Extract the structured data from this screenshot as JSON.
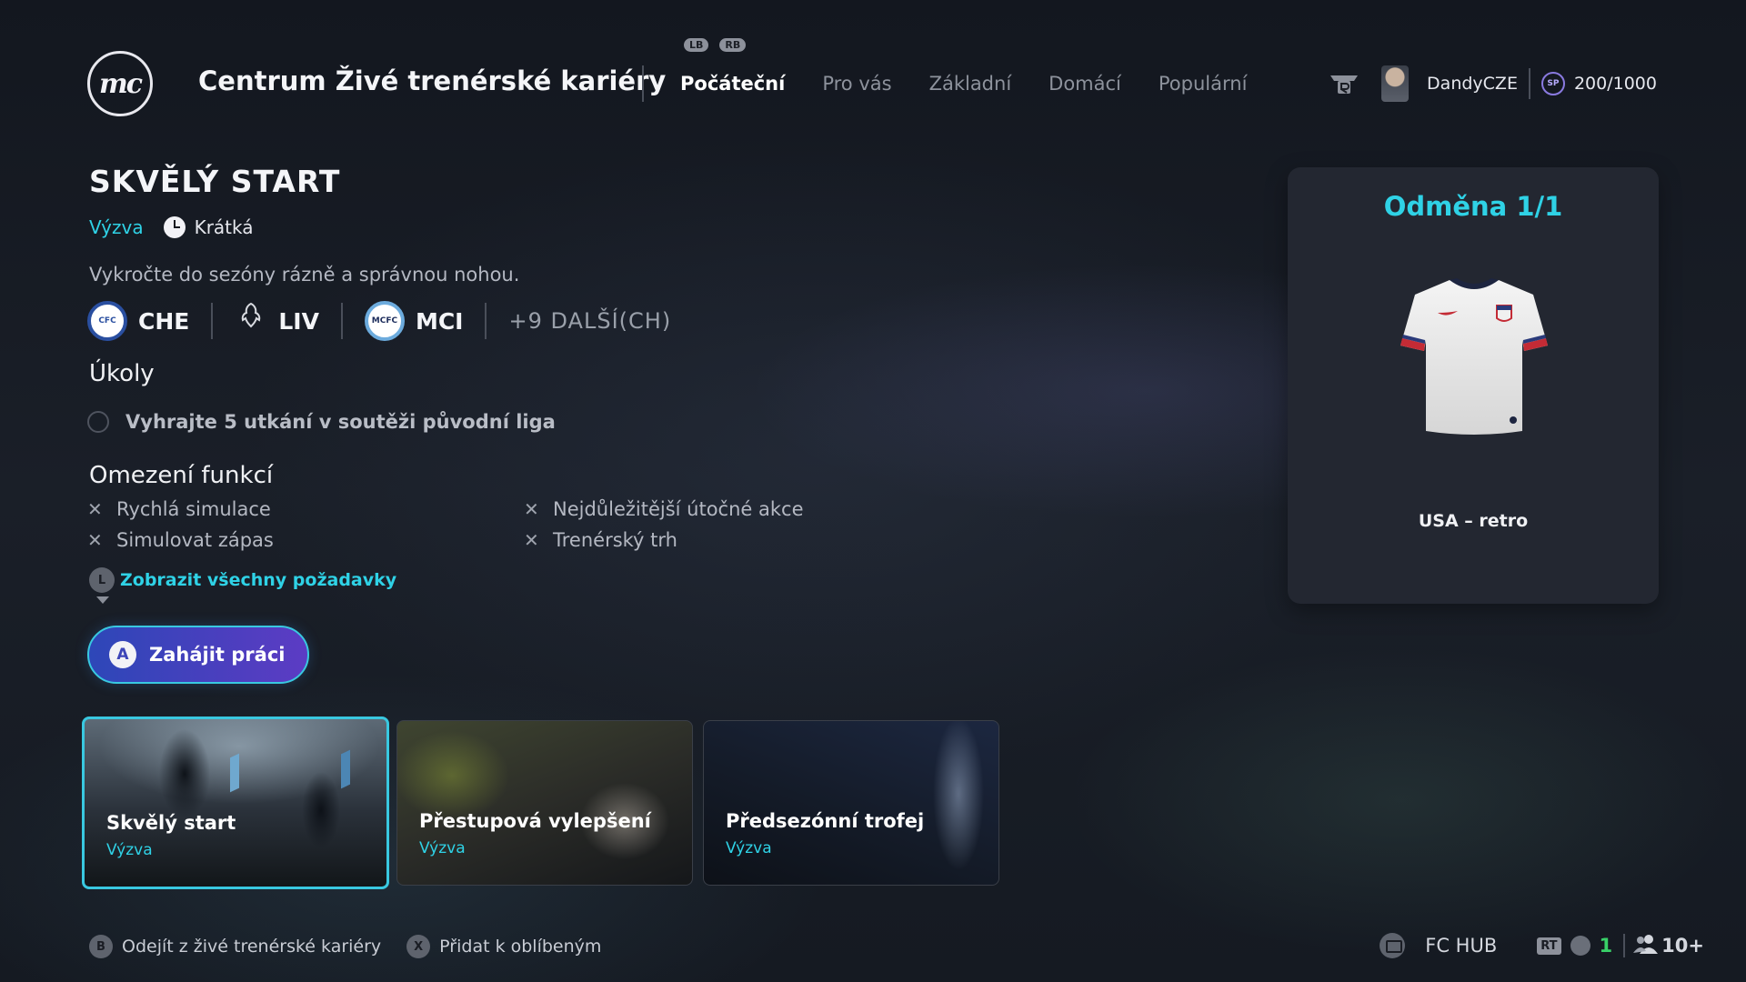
{
  "header": {
    "logo_text": "mc",
    "title": "Centrum Živé trenérské kariéry",
    "bumpers": [
      "LB",
      "RB"
    ],
    "tabs": [
      {
        "label": "Počáteční",
        "active": true
      },
      {
        "label": "Pro vás",
        "active": false
      },
      {
        "label": "Základní",
        "active": false
      },
      {
        "label": "Domácí",
        "active": false
      },
      {
        "label": "Populární",
        "active": false
      }
    ],
    "username": "DandyCZE",
    "sp_label": "SP",
    "sp_value": "200/1000"
  },
  "objective": {
    "title": "SKVĚLÝ START",
    "type": "Výzva",
    "length": "Krátká",
    "description": "Vykročte do sezóny rázně a správnou nohou.",
    "teams": [
      {
        "code": "CHE",
        "crest_text": "CFC"
      },
      {
        "code": "LIV",
        "crest_text": "LFC"
      },
      {
        "code": "MCI",
        "crest_text": "MCFC"
      }
    ],
    "more_teams": "+9 DALŠÍ(CH)",
    "tasks_heading": "Úkoly",
    "tasks": [
      "Vyhrajte 5 utkání v soutěži původní liga"
    ],
    "restrictions_heading": "Omezení funkcí",
    "restrictions": [
      "Rychlá simulace",
      "Nejdůležitější útočné akce",
      "Simulovat zápas",
      "Trenérský trh"
    ],
    "show_all_button_glyph": "L",
    "show_all_label": "Zobrazit všechny požadavky",
    "start_button_glyph": "A",
    "start_label": "Zahájit práci"
  },
  "reward": {
    "title": "Odměna 1/1",
    "item_name": "USA – retro"
  },
  "cards": [
    {
      "title": "Skvělý start",
      "subtitle": "Výzva",
      "selected": true
    },
    {
      "title": "Přestupová vylepšení",
      "subtitle": "Výzva",
      "selected": false
    },
    {
      "title": "Předsezónní trofej",
      "subtitle": "Výzva",
      "selected": false
    }
  ],
  "footer": {
    "back_glyph": "B",
    "back_label": "Odejít z živé trenérské kariéry",
    "fav_glyph": "X",
    "fav_label": "Přidat k oblíbeným",
    "hub_label": "FC HUB",
    "rt_glyph": "RT",
    "notification_count": "1",
    "online_count": "10+"
  },
  "colors": {
    "accent_cyan": "#2fd2e6",
    "button_gradient_start": "#2d47b8",
    "button_gradient_end": "#5c3cc4",
    "online_green": "#38d068"
  }
}
